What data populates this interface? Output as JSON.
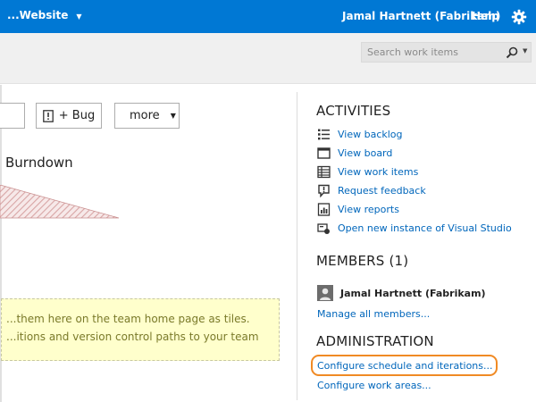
{
  "topbar": {
    "project": "...Website",
    "user": "Jamal Hartnett (Fabrikam)",
    "help": "Help",
    "icons": {
      "project_dropdown": "chevron-down-icon",
      "settings": "gear-icon"
    }
  },
  "search": {
    "placeholder": "Search work items",
    "icons": {
      "search": "search-icon",
      "dropdown": "chevron-down-icon"
    }
  },
  "toolbar": {
    "bug_label": "+ Bug",
    "more_label": "more",
    "icons": {
      "bug": "bug-icon",
      "more": "chevron-down-icon"
    }
  },
  "burndown": {
    "title": "Burndown",
    "hatch_color": "#d8a5a5"
  },
  "tile_hint": {
    "line1": "...them here on the team home page as tiles.",
    "line2": "...itions and version control paths to your team"
  },
  "activities": {
    "title": "ACTIVITIES",
    "items": [
      {
        "label": "View backlog",
        "icon": "backlog-icon"
      },
      {
        "label": "View board",
        "icon": "board-icon"
      },
      {
        "label": "View work items",
        "icon": "work-items-icon"
      },
      {
        "label": "Request feedback",
        "icon": "feedback-icon"
      },
      {
        "label": "View reports",
        "icon": "reports-icon"
      },
      {
        "label": "Open new instance of Visual Studio",
        "icon": "visual-studio-icon"
      }
    ]
  },
  "members": {
    "title": "MEMBERS (1)",
    "list": [
      {
        "name": "Jamal Hartnett (Fabrikam)"
      }
    ],
    "manage_link": "Manage all members..."
  },
  "administration": {
    "title": "ADMINISTRATION",
    "links": [
      "Configure schedule and iterations...",
      "Configure work areas..."
    ]
  },
  "colors": {
    "brand": "#0078d4",
    "link": "#0066bb",
    "highlight": "#f08a24",
    "hint_bg": "#ffffcc"
  }
}
